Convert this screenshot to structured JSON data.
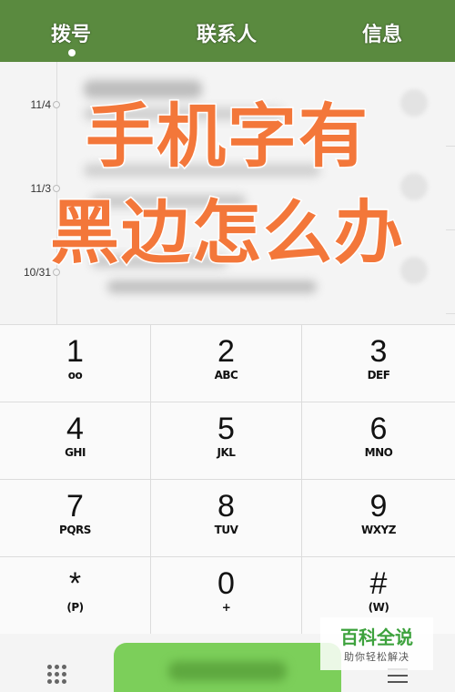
{
  "tabs": [
    {
      "label": "拨号",
      "active": true
    },
    {
      "label": "联系人",
      "active": false
    },
    {
      "label": "信息",
      "active": false
    }
  ],
  "call_log": {
    "dates": [
      "11/4",
      "11/3",
      "10/31"
    ]
  },
  "overlay": {
    "line1": "手机字有",
    "line2": "黑边怎么办"
  },
  "keypad": [
    {
      "digit": "1",
      "letters": "oo"
    },
    {
      "digit": "2",
      "letters": "ABC"
    },
    {
      "digit": "3",
      "letters": "DEF"
    },
    {
      "digit": "4",
      "letters": "GHI"
    },
    {
      "digit": "5",
      "letters": "JKL"
    },
    {
      "digit": "6",
      "letters": "MNO"
    },
    {
      "digit": "7",
      "letters": "PQRS"
    },
    {
      "digit": "8",
      "letters": "TUV"
    },
    {
      "digit": "9",
      "letters": "WXYZ"
    },
    {
      "digit": "*",
      "letters": "(P)"
    },
    {
      "digit": "0",
      "letters": "+"
    },
    {
      "digit": "#",
      "letters": "(W)"
    }
  ],
  "watermark": {
    "title": "百科全说",
    "subtitle": "助你轻松解决"
  },
  "colors": {
    "topbar": "#5a8a3f",
    "overlay_text": "#f3773a",
    "call_button": "#7ccf5a",
    "watermark_green": "#3da23d"
  },
  "icons": {
    "dialpad": "dialpad-icon",
    "menu": "menu-icon",
    "phone": "phone-icon"
  }
}
